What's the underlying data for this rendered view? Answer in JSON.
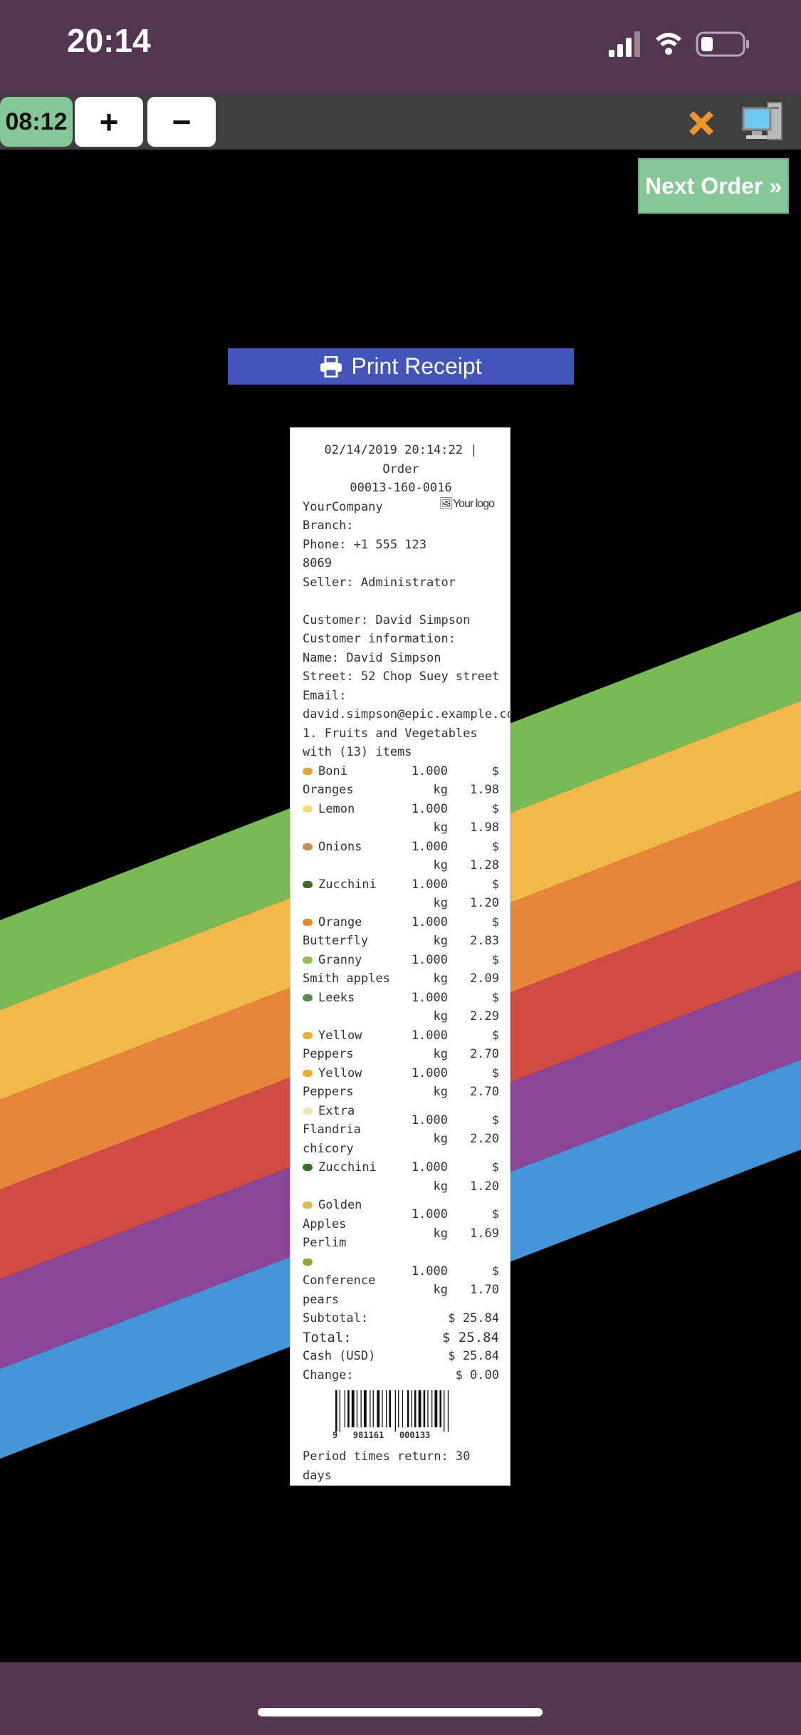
{
  "status_bar": {
    "time": "20:14"
  },
  "toolbar": {
    "timer": "08:12",
    "plus_label": "+",
    "minus_label": "−"
  },
  "actions": {
    "next_order": "Next Order »",
    "print_receipt": "Print Receipt"
  },
  "receipt": {
    "header_line1": "02/14/2019 20:14:22 | Order",
    "header_line2": "00013-160-0016",
    "company": "YourCompany",
    "branch": "Branch:",
    "phone_line1": "Phone: +1 555 123",
    "phone_line2": "8069",
    "seller": "Seller: Administrator",
    "logo_text": "Your logo",
    "customer": "Customer: David Simpson",
    "customer_info": "Customer information:",
    "name": "Name: David Simpson",
    "street": "Street: 52 Chop Suey street",
    "email_label": "Email:",
    "email": "david.simpson@epic.example.com",
    "category_line1": "1. Fruits and Vegetables",
    "category_line2": "with (13) items",
    "items": [
      {
        "name1": "Boni",
        "name2": "Oranges",
        "qty": "1.000",
        "unit": "kg",
        "price": "1.98",
        "dot": "#e8a23a"
      },
      {
        "name1": "Lemon",
        "name2": "",
        "qty": "1.000",
        "unit": "kg",
        "price": "1.98",
        "dot": "#f2dc7a"
      },
      {
        "name1": "Onions",
        "name2": "",
        "qty": "1.000",
        "unit": "kg",
        "price": "1.28",
        "dot": "#c98a4a"
      },
      {
        "name1": "Zucchini",
        "name2": "",
        "qty": "1.000",
        "unit": "kg",
        "price": "1.20",
        "dot": "#3d6b2a"
      },
      {
        "name1": "Orange",
        "name2": "Butterfly",
        "qty": "1.000",
        "unit": "kg",
        "price": "2.83",
        "dot": "#e38a2e"
      },
      {
        "name1": "Granny",
        "name2": "Smith apples",
        "qty": "1.000",
        "unit": "kg",
        "price": "2.09",
        "dot": "#8fbf4a"
      },
      {
        "name1": "Leeks",
        "name2": "",
        "qty": "1.000",
        "unit": "kg",
        "price": "2.29",
        "dot": "#5a8a4a"
      },
      {
        "name1": "Yellow",
        "name2": "Peppers",
        "qty": "1.000",
        "unit": "kg",
        "price": "2.70",
        "dot": "#e8b030"
      },
      {
        "name1": "Yellow",
        "name2": "Peppers",
        "qty": "1.000",
        "unit": "kg",
        "price": "2.70",
        "dot": "#e8b030"
      },
      {
        "name1": "Extra",
        "name2": "Flandria",
        "name3": "chicory",
        "qty": "1.000",
        "unit": "kg",
        "price": "2.20",
        "dot": "#efe6b8"
      },
      {
        "name1": "Zucchini",
        "name2": "",
        "qty": "1.000",
        "unit": "kg",
        "price": "1.20",
        "dot": "#3d6b2a"
      },
      {
        "name1": "Golden",
        "name2": "Apples",
        "name3": "Perlim",
        "qty": "1.000",
        "unit": "kg",
        "price": "1.69",
        "dot": "#d8c050"
      },
      {
        "name1": "",
        "name2": "Conference",
        "name3": "pears",
        "qty": "1.000",
        "unit": "kg",
        "price": "1.70",
        "dot": "#8aa83a"
      }
    ],
    "currency": "$",
    "subtotal_label": "Subtotal:",
    "subtotal": "$ 25.84",
    "total_label": "Total:",
    "total": "$ 25.84",
    "cash_label": "Cash (USD)",
    "cash": "$ 25.84",
    "change_label": "Change:",
    "change": "$ 0.00",
    "barcode_digits": "9   981161   000133",
    "return_line1": "Period times return: 30",
    "return_line2": "days"
  },
  "colors": {
    "status_bar": "#553650",
    "toolbar": "#3f3f3f",
    "accent_green": "#86c797",
    "print_blue": "#4355b9",
    "stripes": [
      "#79b956",
      "#f1b94a",
      "#e7853a",
      "#d14a44",
      "#8a4598",
      "#4596d8"
    ]
  }
}
